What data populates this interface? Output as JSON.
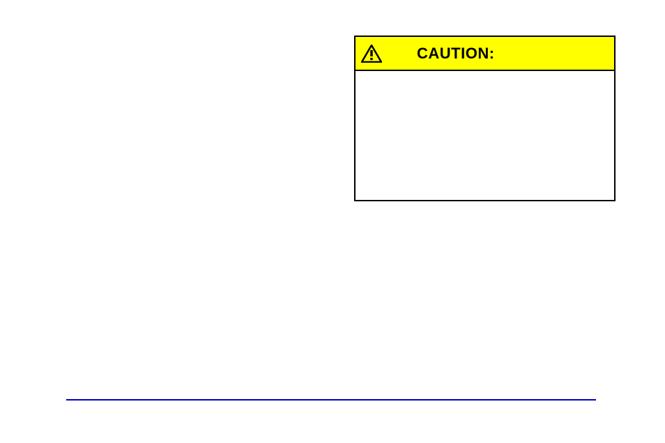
{
  "caution": {
    "title": "CAUTION:"
  },
  "colors": {
    "rule": "#0000c8",
    "bg_header": "#ffff00"
  }
}
